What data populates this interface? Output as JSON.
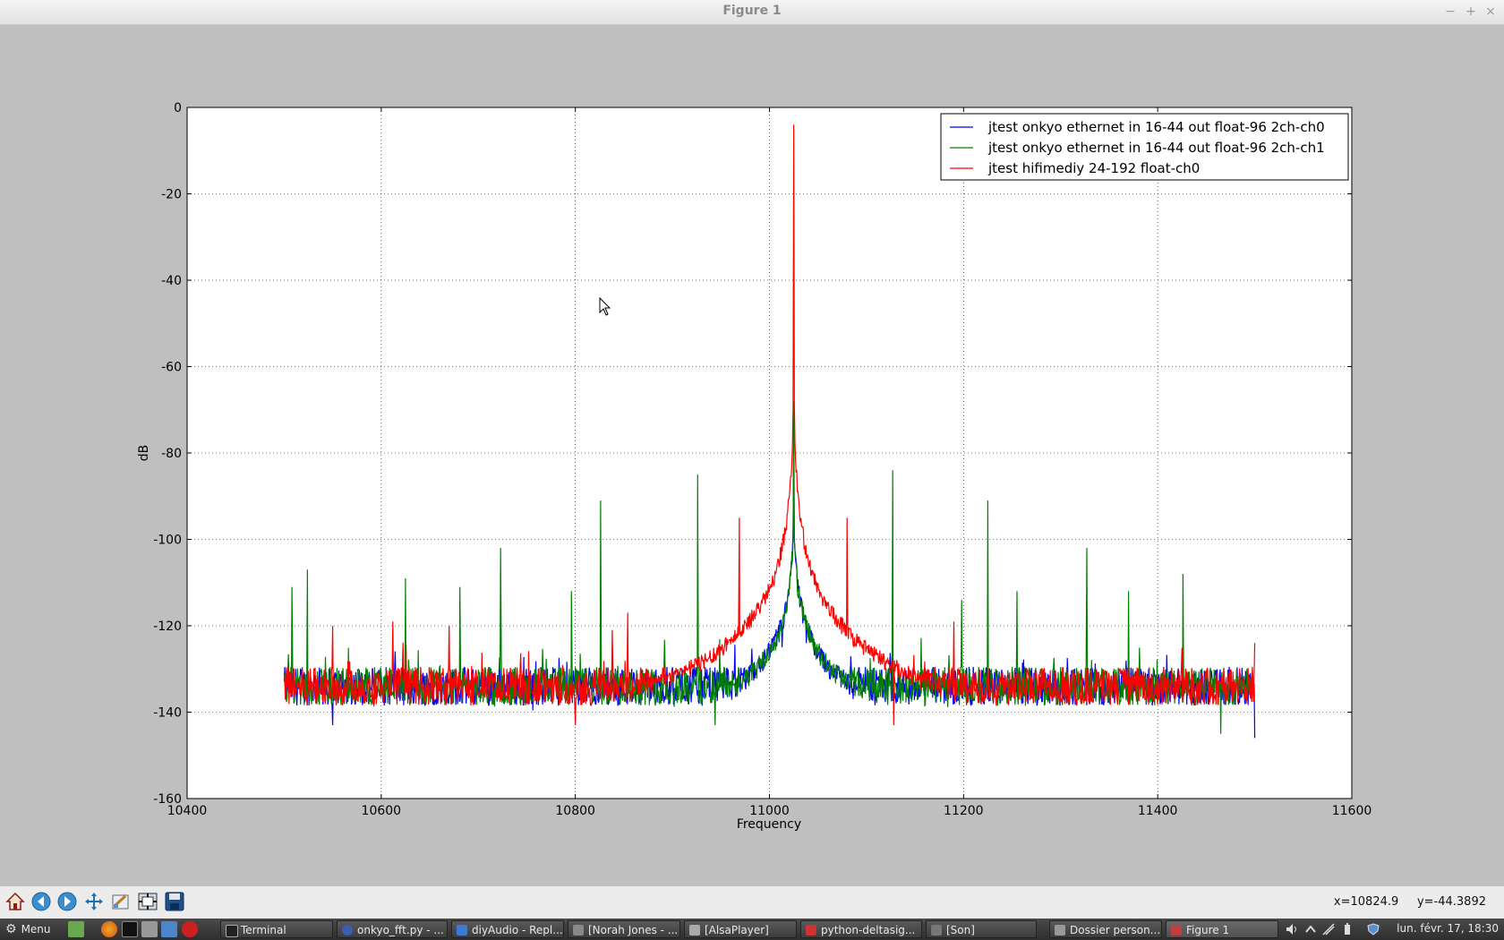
{
  "window": {
    "title": "Figure 1",
    "minimize": "−",
    "maximize": "+",
    "close": "×"
  },
  "chart_data": {
    "type": "line",
    "title": "",
    "xlabel": "Frequency",
    "ylabel": "dB",
    "xlim": [
      10400,
      11600
    ],
    "ylim": [
      -160,
      0
    ],
    "xticks": [
      10400,
      10600,
      10800,
      11000,
      11200,
      11400,
      11600
    ],
    "yticks": [
      0,
      -20,
      -40,
      -60,
      -80,
      -100,
      -120,
      -140,
      -160
    ],
    "grid": true,
    "legend_position": "top-right",
    "data_x_range": [
      10500,
      11500
    ],
    "noise_floor_db": -134,
    "series": [
      {
        "name": "jtest onkyo ethernet in 16-44 out float-96 2ch-ch0",
        "color": "#0000ff",
        "peaks": [
          {
            "x": 11025,
            "y": -82
          },
          {
            "x": 11013,
            "y": -125
          },
          {
            "x": 11038,
            "y": -124
          }
        ],
        "min_points": [
          {
            "x": 11500,
            "y": -146
          },
          {
            "x": 10550,
            "y": -143
          }
        ]
      },
      {
        "name": "jtest onkyo ethernet in 16-44 out float-96 2ch-ch1",
        "color": "#008000",
        "peaks": [
          {
            "x": 10508,
            "y": -111
          },
          {
            "x": 10524,
            "y": -107
          },
          {
            "x": 10625,
            "y": -109
          },
          {
            "x": 10681,
            "y": -111
          },
          {
            "x": 10723,
            "y": -102
          },
          {
            "x": 10796,
            "y": -112
          },
          {
            "x": 10826,
            "y": -91
          },
          {
            "x": 10926,
            "y": -85
          },
          {
            "x": 11025,
            "y": -68
          },
          {
            "x": 11127,
            "y": -84
          },
          {
            "x": 11198,
            "y": -114
          },
          {
            "x": 11225,
            "y": -91
          },
          {
            "x": 11255,
            "y": -112
          },
          {
            "x": 11327,
            "y": -102
          },
          {
            "x": 11370,
            "y": -112
          },
          {
            "x": 11426,
            "y": -108
          }
        ],
        "min_points": [
          {
            "x": 10944,
            "y": -143
          },
          {
            "x": 11465,
            "y": -145
          }
        ]
      },
      {
        "name": "jtest hifimediy 24-192 float-ch0",
        "color": "#ff0000",
        "peaks": [
          {
            "x": 11025,
            "y": -4
          },
          {
            "x": 10969,
            "y": -95
          },
          {
            "x": 11080,
            "y": -95
          },
          {
            "x": 10550,
            "y": -120
          },
          {
            "x": 10612,
            "y": -119
          },
          {
            "x": 10670,
            "y": -120
          },
          {
            "x": 10838,
            "y": -121
          },
          {
            "x": 10854,
            "y": -117
          },
          {
            "x": 11190,
            "y": -119
          },
          {
            "x": 11500,
            "y": -124
          }
        ],
        "min_points": [
          {
            "x": 11128,
            "y": -143
          },
          {
            "x": 10800,
            "y": -143
          }
        ]
      }
    ]
  },
  "toolbar": {
    "buttons": [
      "home-icon",
      "back-icon",
      "forward-icon",
      "pan-icon",
      "zoom-icon",
      "configure-subplots-icon",
      "save-icon"
    ],
    "coord_x": "x=10824.9",
    "coord_y": "y=-44.3892"
  },
  "taskbar": {
    "menu_label": "Menu",
    "tasks": [
      {
        "label": "Terminal",
        "icon_color": "#222222"
      },
      {
        "label": "onkyo_fft.py - ...",
        "icon_color": "#3b5fb0"
      },
      {
        "label": "diyAudio - Repl...",
        "icon_color": "#3a7bd5"
      },
      {
        "label": "[Norah Jones - ...",
        "icon_color": "#888888"
      },
      {
        "label": "[AlsaPlayer]",
        "icon_color": "#aaaaaa"
      },
      {
        "label": "python-deltasig...",
        "icon_color": "#cc3333"
      },
      {
        "label": "[Son]",
        "icon_color": "#777777"
      },
      {
        "label": "Dossier person...",
        "icon_color": "#999999"
      },
      {
        "label": "Figure 1",
        "icon_color": "#c04040"
      }
    ],
    "clock": "lun. févr. 17, 18:30"
  }
}
